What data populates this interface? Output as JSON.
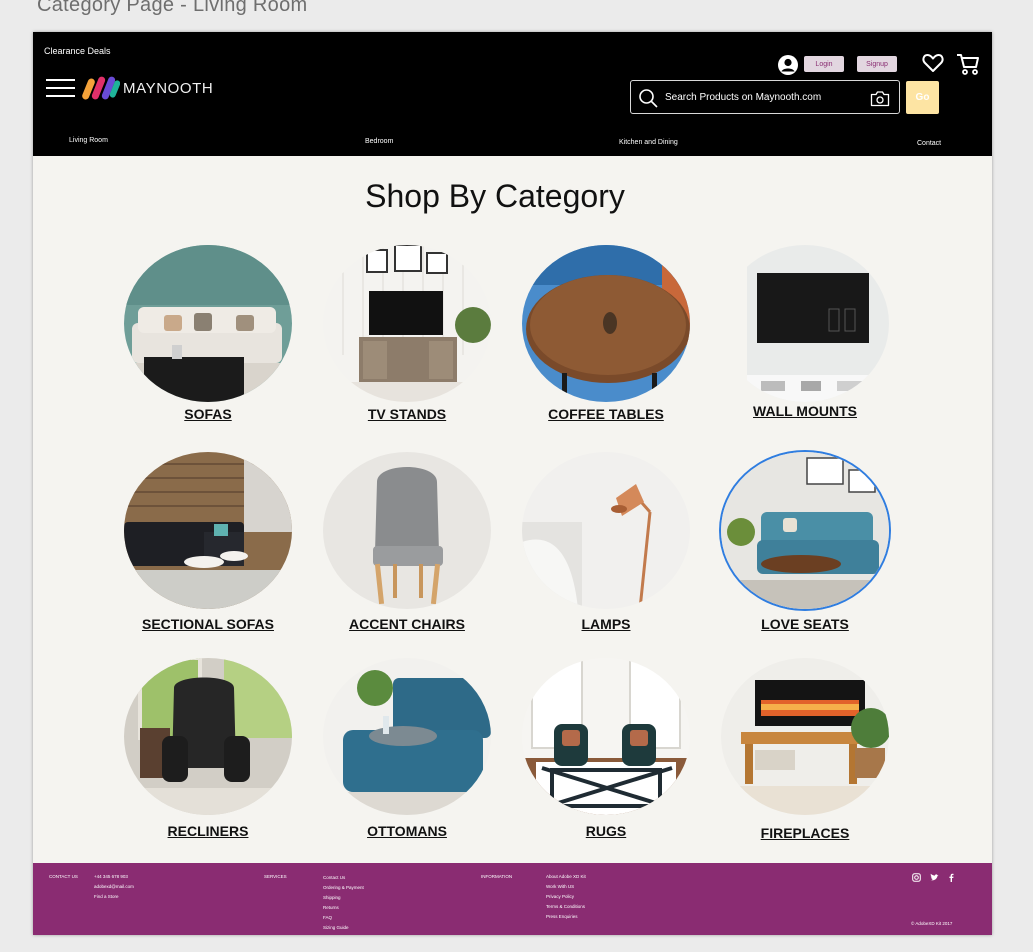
{
  "artboard_title": "Category Page - Living Room",
  "header": {
    "clearance": "Clearance Deals",
    "logo_text": "MAYNOOTH",
    "login": "Login",
    "signup": "Signup",
    "search_placeholder": "Search Products on Maynooth.com",
    "go": "Go",
    "nav": [
      "Living Room",
      "Bedroom",
      "Kitchen and Dining",
      "Contact"
    ]
  },
  "main": {
    "heading": "Shop By Category",
    "categories": [
      {
        "label": "SOFAS",
        "icon": "sofa-image"
      },
      {
        "label": "TV STANDS",
        "icon": "tv-stand-image"
      },
      {
        "label": "COFFEE TABLES",
        "icon": "coffee-table-image"
      },
      {
        "label": "WALL MOUNTS",
        "icon": "wall-mount-image"
      },
      {
        "label": "SECTIONAL SOFAS",
        "icon": "sectional-sofa-image"
      },
      {
        "label": "ACCENT CHAIRS",
        "icon": "accent-chair-image"
      },
      {
        "label": "LAMPS",
        "icon": "lamp-image"
      },
      {
        "label": "LOVE SEATS",
        "icon": "love-seat-image"
      },
      {
        "label": "RECLINERS",
        "icon": "recliner-image"
      },
      {
        "label": "OTTOMANS",
        "icon": "ottoman-image"
      },
      {
        "label": "RUGS",
        "icon": "rug-image"
      },
      {
        "label": "FIREPLACES",
        "icon": "fireplace-image"
      }
    ]
  },
  "footer": {
    "contact_title": "CONTACT US",
    "contact_items": [
      "+44 345 678 903",
      "adobexd@mail.com",
      "Find a Store"
    ],
    "services_title": "SERVICES",
    "services_items": [
      "Contact Us",
      "Ordering & Payment",
      "Shipping",
      "Returns",
      "FAQ",
      "Sizing Guide"
    ],
    "info_title": "INFORMATION",
    "info_items": [
      "About Adobe XD Kit",
      "Work With US",
      "Privacy Policy",
      "Terms & Conditions",
      "Press Enquiries"
    ],
    "copyright": "© AdobeXD Kit 2017"
  },
  "colors": {
    "header_bg": "#000000",
    "page_bg": "#f5f4f0",
    "footer_bg": "#8a2c72",
    "go_button": "#fde4a3",
    "login_button": "#e2d6e0",
    "selected_outline": "#2f7de0"
  }
}
